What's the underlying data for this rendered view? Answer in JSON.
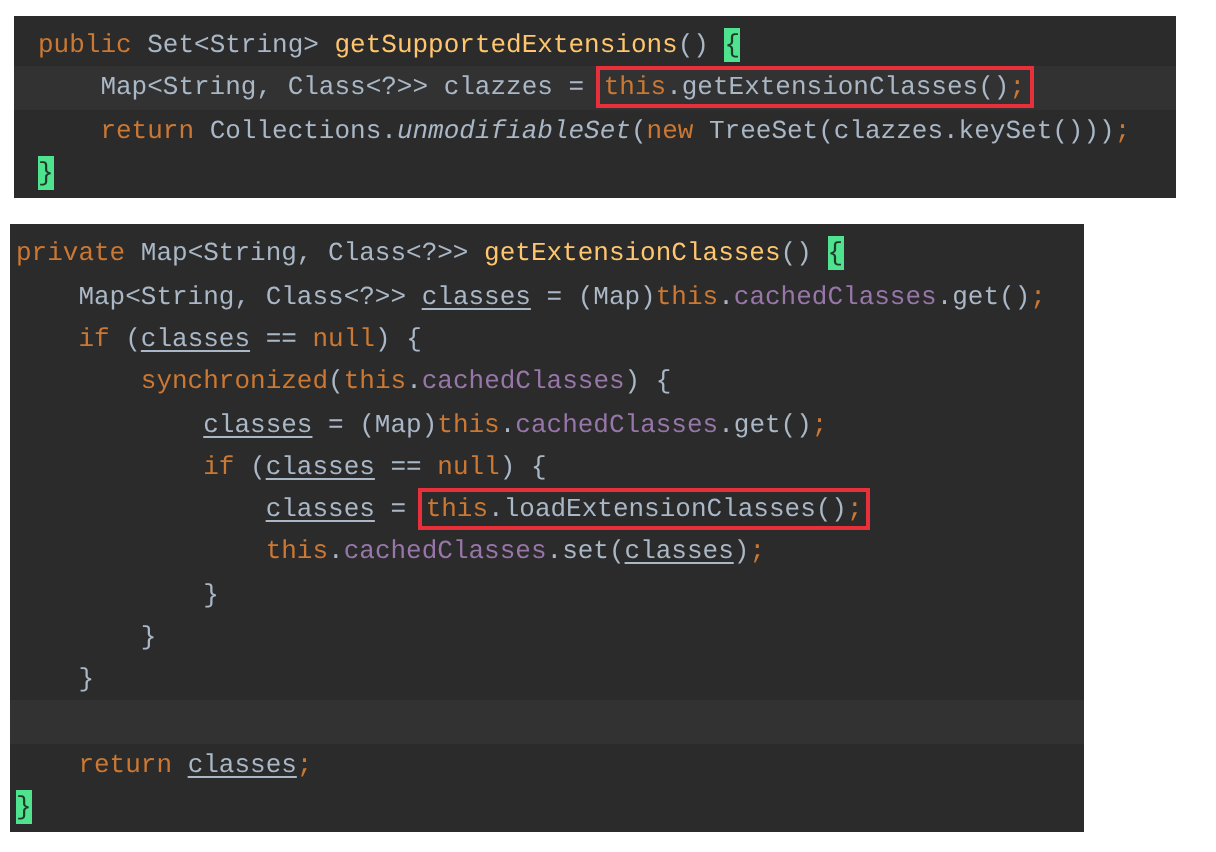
{
  "panels": [
    {
      "lines": [
        {
          "current": false,
          "segments": [
            {
              "kind": "plain",
              "tokens": [
                {
                  "kind": "kw",
                  "text": "public"
                },
                {
                  "kind": "plain",
                  "text": " Set<String> "
                },
                {
                  "kind": "decl",
                  "text": "getSupportedExtensions"
                },
                {
                  "kind": "plain",
                  "text": "() "
                }
              ]
            },
            {
              "kind": "matched-brace",
              "tokens": [
                {
                  "kind": "plain",
                  "text": "{"
                }
              ]
            }
          ],
          "children": [
            {
              "current": true,
              "segments": [
                {
                  "kind": "plain",
                  "tokens": [
                    {
                      "kind": "plain",
                      "text": "Map<String, Class<?>> clazzes = "
                    }
                  ]
                },
                {
                  "kind": "boxed",
                  "tokens": [
                    {
                      "kind": "kw",
                      "text": "this"
                    },
                    {
                      "kind": "plain",
                      "text": ".getExtensionClasses()"
                    },
                    {
                      "kind": "kw",
                      "text": ";"
                    }
                  ]
                }
              ]
            },
            {
              "current": false,
              "segments": [
                {
                  "kind": "plain",
                  "tokens": [
                    {
                      "kind": "kw",
                      "text": "return"
                    },
                    {
                      "kind": "plain",
                      "text": " Collections."
                    },
                    {
                      "kind": "static",
                      "text": "unmodifiableSet"
                    },
                    {
                      "kind": "plain",
                      "text": "("
                    },
                    {
                      "kind": "kw",
                      "text": "new"
                    },
                    {
                      "kind": "plain",
                      "text": " TreeSet(clazzes.keySet()))"
                    },
                    {
                      "kind": "kw",
                      "text": ";"
                    }
                  ]
                }
              ]
            }
          ]
        },
        {
          "current": false,
          "segments": [
            {
              "kind": "matched-brace",
              "tokens": [
                {
                  "kind": "plain",
                  "text": "}"
                }
              ]
            }
          ]
        }
      ]
    },
    {
      "lines": [
        {
          "current": false,
          "segments": [
            {
              "kind": "plain",
              "tokens": [
                {
                  "kind": "kw",
                  "text": "private"
                },
                {
                  "kind": "plain",
                  "text": " Map<String, Class<?>> "
                },
                {
                  "kind": "decl",
                  "text": "getExtensionClasses"
                },
                {
                  "kind": "plain",
                  "text": "() "
                }
              ]
            },
            {
              "kind": "matched-brace",
              "tokens": [
                {
                  "kind": "plain",
                  "text": "{"
                }
              ]
            }
          ],
          "children": [
            {
              "current": false,
              "segments": [
                {
                  "kind": "plain",
                  "tokens": [
                    {
                      "kind": "plain",
                      "text": "Map<String, Class<?>> "
                    },
                    {
                      "kind": "local",
                      "text": "classes"
                    },
                    {
                      "kind": "plain",
                      "text": " = (Map)"
                    },
                    {
                      "kind": "kw",
                      "text": "this"
                    },
                    {
                      "kind": "plain",
                      "text": "."
                    },
                    {
                      "kind": "field",
                      "text": "cachedClasses"
                    },
                    {
                      "kind": "plain",
                      "text": ".get()"
                    },
                    {
                      "kind": "kw",
                      "text": ";"
                    }
                  ]
                }
              ]
            },
            {
              "current": false,
              "segments": [
                {
                  "kind": "plain",
                  "tokens": [
                    {
                      "kind": "kw",
                      "text": "if"
                    },
                    {
                      "kind": "plain",
                      "text": " ("
                    },
                    {
                      "kind": "local",
                      "text": "classes"
                    },
                    {
                      "kind": "plain",
                      "text": " == "
                    },
                    {
                      "kind": "kw",
                      "text": "null"
                    },
                    {
                      "kind": "plain",
                      "text": ") {"
                    }
                  ]
                }
              ],
              "children": [
                {
                  "current": false,
                  "segments": [
                    {
                      "kind": "plain",
                      "tokens": [
                        {
                          "kind": "kw",
                          "text": "synchronized"
                        },
                        {
                          "kind": "plain",
                          "text": "("
                        },
                        {
                          "kind": "kw",
                          "text": "this"
                        },
                        {
                          "kind": "plain",
                          "text": "."
                        },
                        {
                          "kind": "field",
                          "text": "cachedClasses"
                        },
                        {
                          "kind": "plain",
                          "text": ") {"
                        }
                      ]
                    }
                  ],
                  "children": [
                    {
                      "current": false,
                      "segments": [
                        {
                          "kind": "plain",
                          "tokens": [
                            {
                              "kind": "local",
                              "text": "classes"
                            },
                            {
                              "kind": "plain",
                              "text": " = (Map)"
                            },
                            {
                              "kind": "kw",
                              "text": "this"
                            },
                            {
                              "kind": "plain",
                              "text": "."
                            },
                            {
                              "kind": "field",
                              "text": "cachedClasses"
                            },
                            {
                              "kind": "plain",
                              "text": ".get()"
                            },
                            {
                              "kind": "kw",
                              "text": ";"
                            }
                          ]
                        }
                      ]
                    },
                    {
                      "current": false,
                      "segments": [
                        {
                          "kind": "plain",
                          "tokens": [
                            {
                              "kind": "kw",
                              "text": "if"
                            },
                            {
                              "kind": "plain",
                              "text": " ("
                            },
                            {
                              "kind": "local",
                              "text": "classes"
                            },
                            {
                              "kind": "plain",
                              "text": " == "
                            },
                            {
                              "kind": "kw",
                              "text": "null"
                            },
                            {
                              "kind": "plain",
                              "text": ") {"
                            }
                          ]
                        }
                      ],
                      "children": [
                        {
                          "current": false,
                          "segments": [
                            {
                              "kind": "plain",
                              "tokens": [
                                {
                                  "kind": "local",
                                  "text": "classes"
                                },
                                {
                                  "kind": "plain",
                                  "text": " = "
                                }
                              ]
                            },
                            {
                              "kind": "boxed",
                              "tokens": [
                                {
                                  "kind": "kw",
                                  "text": "this"
                                },
                                {
                                  "kind": "plain",
                                  "text": ".loadExtensionClasses()"
                                },
                                {
                                  "kind": "kw",
                                  "text": ";"
                                }
                              ]
                            }
                          ]
                        },
                        {
                          "current": false,
                          "segments": [
                            {
                              "kind": "plain",
                              "tokens": [
                                {
                                  "kind": "kw",
                                  "text": "this"
                                },
                                {
                                  "kind": "plain",
                                  "text": "."
                                },
                                {
                                  "kind": "field",
                                  "text": "cachedClasses"
                                },
                                {
                                  "kind": "plain",
                                  "text": ".set("
                                },
                                {
                                  "kind": "local",
                                  "text": "classes"
                                },
                                {
                                  "kind": "plain",
                                  "text": ")"
                                },
                                {
                                  "kind": "kw",
                                  "text": ";"
                                }
                              ]
                            }
                          ]
                        }
                      ]
                    },
                    {
                      "current": false,
                      "segments": [
                        {
                          "kind": "plain",
                          "tokens": [
                            {
                              "kind": "plain",
                              "text": "}"
                            }
                          ]
                        }
                      ]
                    }
                  ]
                },
                {
                  "current": false,
                  "segments": [
                    {
                      "kind": "plain",
                      "tokens": [
                        {
                          "kind": "plain",
                          "text": "}"
                        }
                      ]
                    }
                  ]
                }
              ]
            },
            {
              "current": false,
              "segments": [
                {
                  "kind": "plain",
                  "tokens": [
                    {
                      "kind": "plain",
                      "text": "}"
                    }
                  ]
                }
              ]
            },
            {
              "current": true
            },
            {
              "current": false,
              "segments": [
                {
                  "kind": "plain",
                  "tokens": [
                    {
                      "kind": "kw",
                      "text": "return "
                    },
                    {
                      "kind": "local",
                      "text": "classes"
                    },
                    {
                      "kind": "kw",
                      "text": ";"
                    }
                  ]
                }
              ]
            }
          ]
        },
        {
          "current": false,
          "segments": [
            {
              "kind": "matched-brace",
              "tokens": [
                {
                  "kind": "plain",
                  "text": "}"
                }
              ]
            }
          ]
        }
      ]
    }
  ]
}
